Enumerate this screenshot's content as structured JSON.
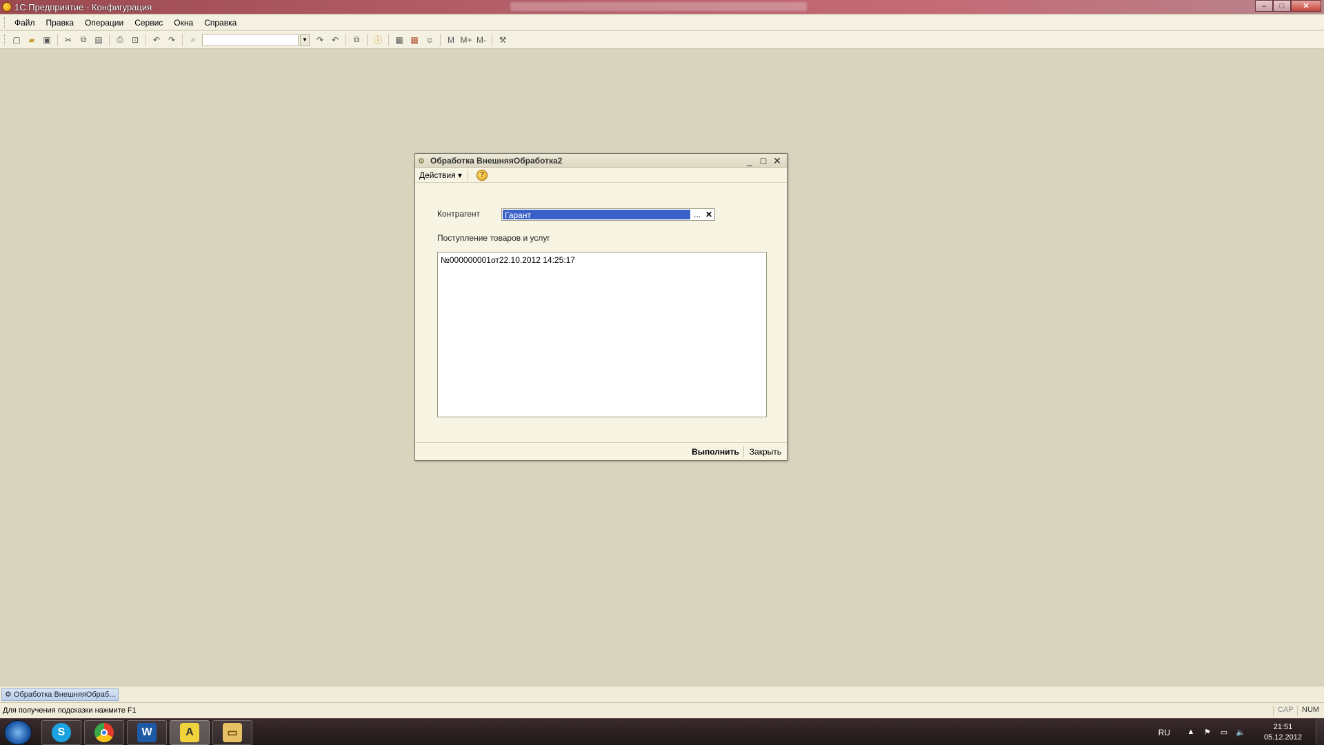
{
  "window": {
    "title": "1С:Предприятие - Конфигурация",
    "controls": {
      "minimize": "–",
      "maximize": "□",
      "close": "✕"
    }
  },
  "menu": [
    "Файл",
    "Правка",
    "Операции",
    "Сервис",
    "Окна",
    "Справка"
  ],
  "toolbar": {
    "icons": [
      "new-icon",
      "open-icon",
      "save-icon",
      "cut-icon",
      "copy-icon",
      "paste-icon",
      "print-icon",
      "print-preview-icon",
      "undo-icon",
      "redo-icon",
      "search-icon",
      "find-next-icon",
      "find-prev-icon",
      "windows-icon",
      "info-icon",
      "calculator-icon",
      "calendar-icon",
      "users-icon",
      "m-icon",
      "m-plus-icon",
      "m-minus-icon",
      "tools-icon"
    ],
    "memory": {
      "m": "M",
      "m_plus": "M+",
      "m_minus": "M-"
    }
  },
  "dialog": {
    "title": "Обработка  ВнешняяОбработка2",
    "actions_label": "Действия",
    "help": "?",
    "contractor_label": "Контрагент",
    "contractor_value": "Гарант",
    "dots": "...",
    "clear": "✕",
    "list_label": "Поступление товаров и услуг",
    "list_items": [
      "№000000001от22.10.2012 14:25:17"
    ],
    "execute": "Выполнить",
    "close": "Закрыть"
  },
  "window_panel": {
    "item": "Обработка  ВнешняяОбраб..."
  },
  "statusbar": {
    "hint": "Для получения подсказки нажмите F1",
    "cap": "CAP",
    "num": "NUM"
  },
  "taskbar": {
    "apps": [
      "skype",
      "chrome",
      "word",
      "1c",
      "explorer"
    ],
    "lang": "RU",
    "time": "21:51",
    "date": "05.12.2012"
  },
  "colors": {
    "workspace": "#d8d4be",
    "selection": "#3a61c8",
    "titlebar": "#b4606a"
  }
}
